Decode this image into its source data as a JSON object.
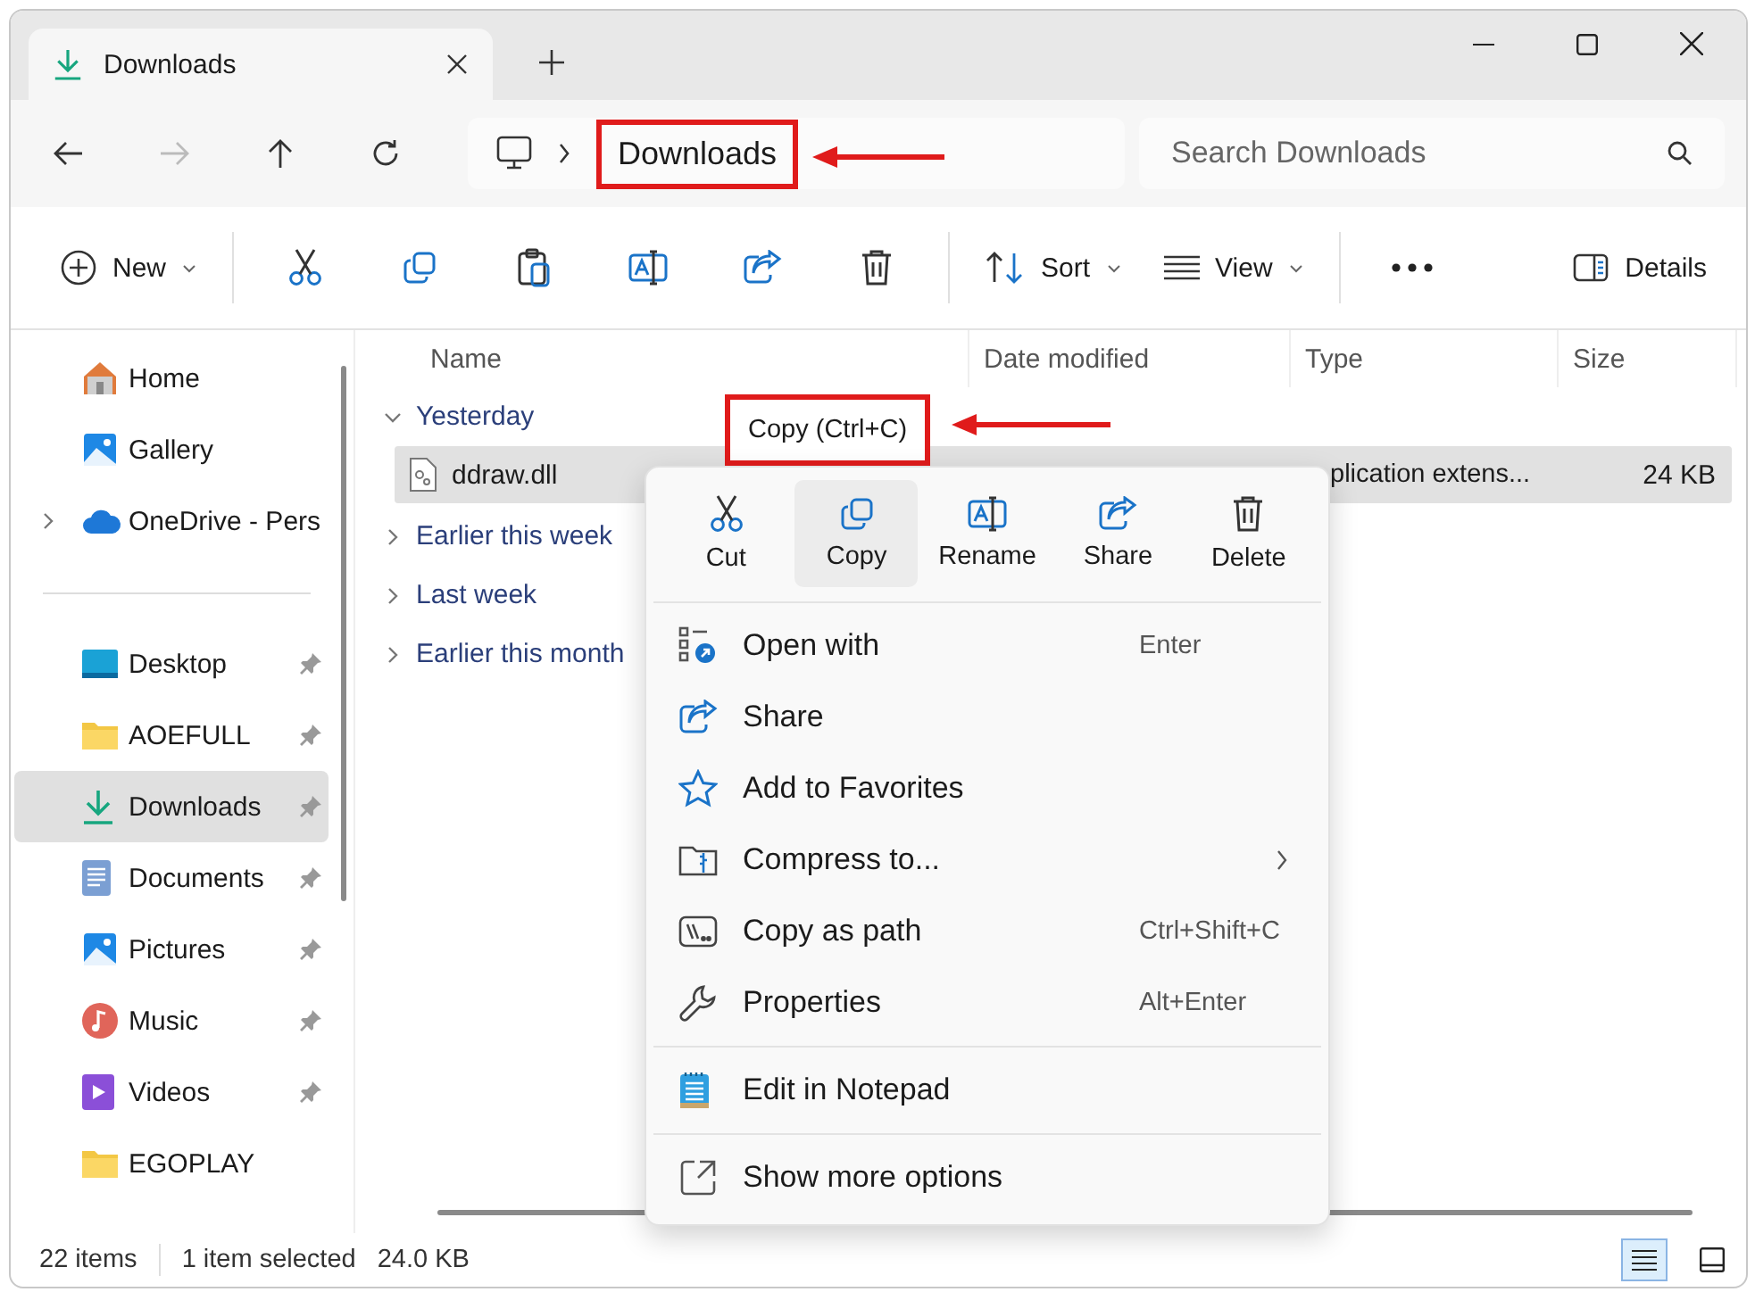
{
  "window": {
    "tab_title": "Downloads"
  },
  "address_bar": {
    "breadcrumb": [
      {
        "label": "Downloads",
        "highlighted": true
      }
    ],
    "search": {
      "placeholder": "Search Downloads"
    }
  },
  "toolbar": [
    {
      "kind": "new",
      "label": "New"
    },
    {
      "kind": "cut"
    },
    {
      "kind": "copy"
    },
    {
      "kind": "paste"
    },
    {
      "kind": "rename"
    },
    {
      "kind": "share"
    },
    {
      "kind": "delete"
    },
    {
      "kind": "sort",
      "label": "Sort"
    },
    {
      "kind": "view",
      "label": "View"
    },
    {
      "kind": "more"
    },
    {
      "kind": "details",
      "label": "Details"
    }
  ],
  "sidebar": {
    "groups": [
      [
        {
          "kind": "home",
          "label": "Home",
          "selected": false,
          "pinned": false,
          "expandable": false
        },
        {
          "kind": "gallery",
          "label": "Gallery",
          "selected": false,
          "pinned": false,
          "expandable": false
        },
        {
          "kind": "cloud",
          "label": "OneDrive - Pers",
          "selected": false,
          "pinned": false,
          "expandable": true
        }
      ],
      [
        {
          "kind": "desktop",
          "label": "Desktop",
          "selected": false,
          "pinned": true,
          "expandable": false
        },
        {
          "kind": "folder",
          "label": "AOEFULL",
          "selected": false,
          "pinned": true,
          "expandable": false
        },
        {
          "kind": "downloads",
          "label": "Downloads",
          "selected": true,
          "pinned": true,
          "expandable": false
        },
        {
          "kind": "documents",
          "label": "Documents",
          "selected": false,
          "pinned": true,
          "expandable": false
        },
        {
          "kind": "pictures",
          "label": "Pictures",
          "selected": false,
          "pinned": true,
          "expandable": false
        },
        {
          "kind": "music",
          "label": "Music",
          "selected": false,
          "pinned": true,
          "expandable": false
        },
        {
          "kind": "videos",
          "label": "Videos",
          "selected": false,
          "pinned": true,
          "expandable": false
        },
        {
          "kind": "folder",
          "label": "EGOPLAY",
          "selected": false,
          "pinned": false,
          "expandable": false
        }
      ]
    ]
  },
  "file_list": {
    "columns": [
      "Name",
      "Date modified",
      "Type",
      "Size"
    ],
    "groups": [
      {
        "label": "Yesterday",
        "expanded": true,
        "files": [
          {
            "name": "ddraw.dll",
            "type": "plication extens...",
            "size": "24 KB",
            "selected": true
          }
        ]
      },
      {
        "label": "Earlier this week",
        "expanded": false
      },
      {
        "label": "Last week",
        "expanded": false
      },
      {
        "label": "Earlier this month",
        "expanded": false
      }
    ]
  },
  "tooltip": {
    "text": "Copy (Ctrl+C)",
    "highlighted": true
  },
  "context_menu": {
    "actions": [
      {
        "kind": "cut",
        "label": "Cut",
        "selected": false
      },
      {
        "kind": "copy",
        "label": "Copy",
        "selected": true
      },
      {
        "kind": "rename",
        "label": "Rename",
        "selected": false
      },
      {
        "kind": "share",
        "label": "Share",
        "selected": false
      },
      {
        "kind": "delete",
        "label": "Delete",
        "selected": false
      }
    ],
    "sections": [
      [
        {
          "kind": "openwith",
          "label": "Open with",
          "shortcut": "Enter",
          "submenu": false
        },
        {
          "kind": "share",
          "label": "Share",
          "submenu": false
        },
        {
          "kind": "star",
          "label": "Add to Favorites",
          "submenu": false
        },
        {
          "kind": "compress",
          "label": "Compress to...",
          "submenu": true
        },
        {
          "kind": "path",
          "label": "Copy as path",
          "shortcut": "Ctrl+Shift+C",
          "submenu": false
        },
        {
          "kind": "wrench",
          "label": "Properties",
          "shortcut": "Alt+Enter",
          "submenu": false
        }
      ],
      [
        {
          "kind": "notepad",
          "label": "Edit in Notepad",
          "submenu": false
        }
      ],
      [
        {
          "kind": "external",
          "label": "Show more options",
          "submenu": false
        }
      ]
    ]
  },
  "status_bar": {
    "item_count": "22 items",
    "selection": "1 item selected",
    "size": "24.0 KB",
    "view_modes": [
      {
        "kind": "details",
        "selected": true
      },
      {
        "kind": "tiles",
        "selected": false
      }
    ]
  }
}
